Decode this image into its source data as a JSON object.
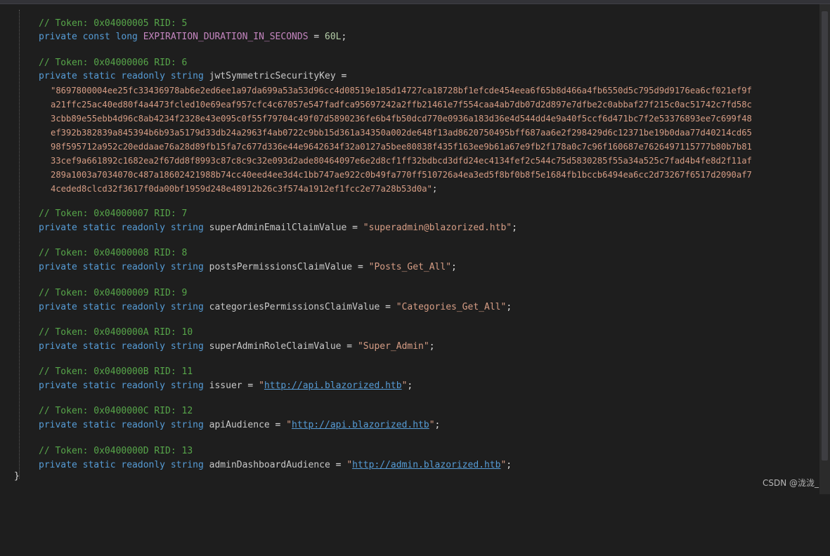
{
  "fields": [
    {
      "comment": "// Token: 0x04000005 RID: 5",
      "modifiers": "private const long",
      "name": "EXPIRATION_DURATION_IN_SECONDS",
      "rest": " = ",
      "value": "60L",
      "end": ";"
    },
    {
      "comment": "// Token: 0x04000006 RID: 6",
      "modifiers": "private static readonly string",
      "name": "jwtSymmetricSecurityKey",
      "rest": " ="
    },
    {
      "comment": "// Token: 0x04000007 RID: 7",
      "modifiers": "private static readonly string",
      "name": "superAdminEmailClaimValue",
      "rest": " = ",
      "value": "\"superadmin@blazorized.htb\"",
      "end": ";"
    },
    {
      "comment": "// Token: 0x04000008 RID: 8",
      "modifiers": "private static readonly string",
      "name": "postsPermissionsClaimValue",
      "rest": " = ",
      "value": "\"Posts_Get_All\"",
      "end": ";"
    },
    {
      "comment": "// Token: 0x04000009 RID: 9",
      "modifiers": "private static readonly string",
      "name": "categoriesPermissionsClaimValue",
      "rest": " = ",
      "value": "\"Categories_Get_All\"",
      "end": ";"
    },
    {
      "comment": "// Token: 0x0400000A RID: 10",
      "modifiers": "private static readonly string",
      "name": "superAdminRoleClaimValue",
      "rest": " = ",
      "value": "\"Super_Admin\"",
      "end": ";"
    },
    {
      "comment": "// Token: 0x0400000B RID: 11",
      "modifiers": "private static readonly string",
      "name": "issuer",
      "rest": " = ",
      "q1": "\"",
      "link": "http://api.blazorized.htb",
      "q2": "\"",
      "end": ";"
    },
    {
      "comment": "// Token: 0x0400000C RID: 12",
      "modifiers": "private static readonly string",
      "name": "apiAudience",
      "rest": " = ",
      "q1": "\"",
      "link": "http://api.blazorized.htb",
      "q2": "\"",
      "end": ";"
    },
    {
      "comment": "// Token: 0x0400000D RID: 13",
      "modifiers": "private static readonly string",
      "name": "adminDashboardAudience",
      "rest": " = ",
      "q1": "\"",
      "link": "http://admin.blazorized.htb",
      "q2": "\"",
      "end": ";"
    }
  ],
  "key_lines": [
    "\"8697800004ee25fc33436978ab6e2ed6ee1a97da699a53a53d96cc4d08519e185d14727ca18728bf1efcde454eea6f65b8d466a4fb6550d5c795d9d9176ea6cf021ef9f",
    "a21ffc25ac40ed80f4a4473fcled10e69eaf957cfc4c67057e547fadfca95697242a2ffb21461e7f554caa4ab7db07d2d897e7dfbe2c0abbaf27f215c0ac51742c7fd58c",
    "3cbb89e55ebb4d96c8ab4234f2328e43e095c0f55f79704c49f07d5890236fe6b4fb50dcd770e0936a183d36e4d544dd4e9a40f5ccf6d471bc7f2e53376893ee7c699f48",
    "ef392b382839a845394b6b93a5179d33db24a2963f4ab0722c9bb15d361a34350a002de648f13ad8620750495bff687aa6e2f298429d6c12371be19b0daa77d40214cd65",
    "98f595712a952c20eddaae76a28d89fb15fa7c677d336e44e9642634f32a0127a5bee80838f435f163ee9b61a67e9fb2f178a0c7c96f160687e7626497115777b80b7b81",
    "33cef9a661892c1682ea2f67dd8f8993c87c8c9c32e093d2ade80464097e6e2d8cf1ff32bdbcd3dfd24ec4134fef2c544c75d5830285f55a34a525c7fad4b4fe8d2f11af",
    "289a1003a7034070c487a18602421988b74cc40eed4ee3d4c1bb747ae922c0b49fa770ff510726a4ea3ed5f8bf0b8f5e1684fb1bccb6494ea6cc2d73267f6517d2090af7",
    "4ceded8clcd32f3617f0da00bf1959d248e48912b26c3f574a1912ef1fcc2e77a28b53d0a\""
  ],
  "key_end": ";",
  "closing_brace": "}",
  "watermark": "CSDN @泷泷_"
}
